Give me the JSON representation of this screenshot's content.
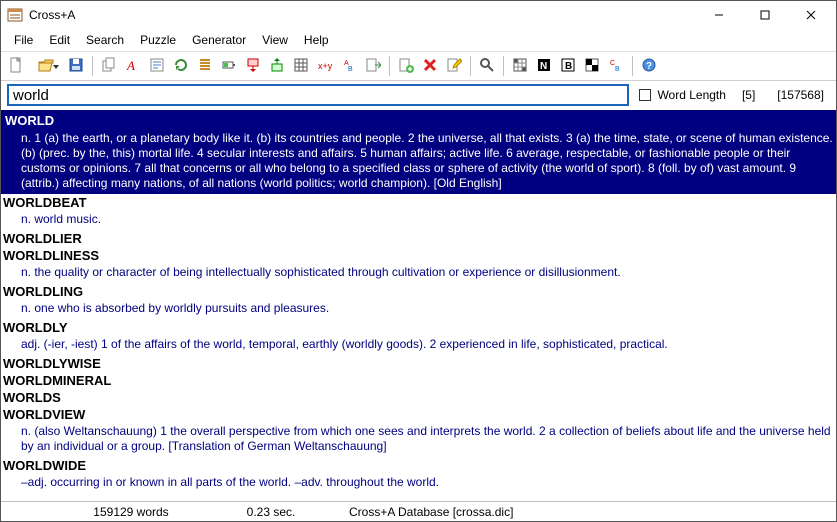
{
  "window": {
    "title": "Cross+A"
  },
  "menu": {
    "items": [
      "File",
      "Edit",
      "Search",
      "Puzzle",
      "Generator",
      "View",
      "Help"
    ]
  },
  "toolbar": {
    "groups": [
      [
        "new-icon",
        "open-icon",
        "save-icon"
      ],
      [
        "copy-icon",
        "font-a-icon",
        "words-icon",
        "refresh-icon",
        "list-icon",
        "battery-icon",
        "flag-down-icon",
        "flag-up-icon",
        "grid-icon",
        "xy-icon",
        "ab-icon",
        "export-icon"
      ],
      [
        "add-icon",
        "delete-icon",
        "edit-icon"
      ],
      [
        "search-icon"
      ],
      [
        "grid2-icon",
        "n-icon",
        "b-icon",
        "chess-icon",
        "cb-icon"
      ],
      [
        "help-icon"
      ]
    ]
  },
  "search": {
    "value": "world",
    "word_length_label": "Word Length",
    "word_length_checked": false,
    "len": "[5]",
    "count": "[157568]"
  },
  "results": [
    {
      "word": "WORLD",
      "selected": true,
      "def": "n. 1 (a) the earth, or a planetary body like it. (b) its countries and people. 2 the universe, all that exists. 3 (a) the time, state, or scene of human existence. (b) (prec. by the, this) mortal life. 4 secular interests and affairs. 5 human affairs; active life. 6 average, respectable, or fashionable people or their customs or opinions. 7 all that concerns or all who belong to a specified class or sphere of activity (the world of sport). 8 (foll. by of) vast amount. 9 (attrib.) affecting many nations, of all nations (world politics; world champion). [Old English]"
    },
    {
      "word": "WORLDBEAT",
      "def": "n. world music."
    },
    {
      "word": "WORLDLIER",
      "def": ""
    },
    {
      "word": "WORLDLINESS",
      "def": "n. the quality or character of being intellectually sophisticated through cultivation or experience or disillusionment."
    },
    {
      "word": "WORLDLING",
      "def": "n. one who is absorbed by worldly pursuits and pleasures."
    },
    {
      "word": "WORLDLY",
      "def": "adj. (-ier, -iest) 1 of the affairs of the world, temporal, earthly (worldly goods). 2 experienced in life, sophisticated, practical."
    },
    {
      "word": "WORLDLYWISE",
      "def": ""
    },
    {
      "word": "WORLDMINERAL",
      "def": ""
    },
    {
      "word": "WORLDS",
      "def": ""
    },
    {
      "word": "WORLDVIEW",
      "def": "n. (also Weltanschauung) 1 the overall perspective from which one sees and interprets the world. 2 a collection of beliefs about life and the universe held by an individual or a group. [Translation of German Weltanschauung]"
    },
    {
      "word": "WORLDWIDE",
      "def": "–adj. occurring in or known in all parts of the world. –adv. throughout the world."
    }
  ],
  "status": {
    "words": "159129 words",
    "time": "0.23 sec.",
    "db": "Cross+A Database [crossa.dic]"
  }
}
